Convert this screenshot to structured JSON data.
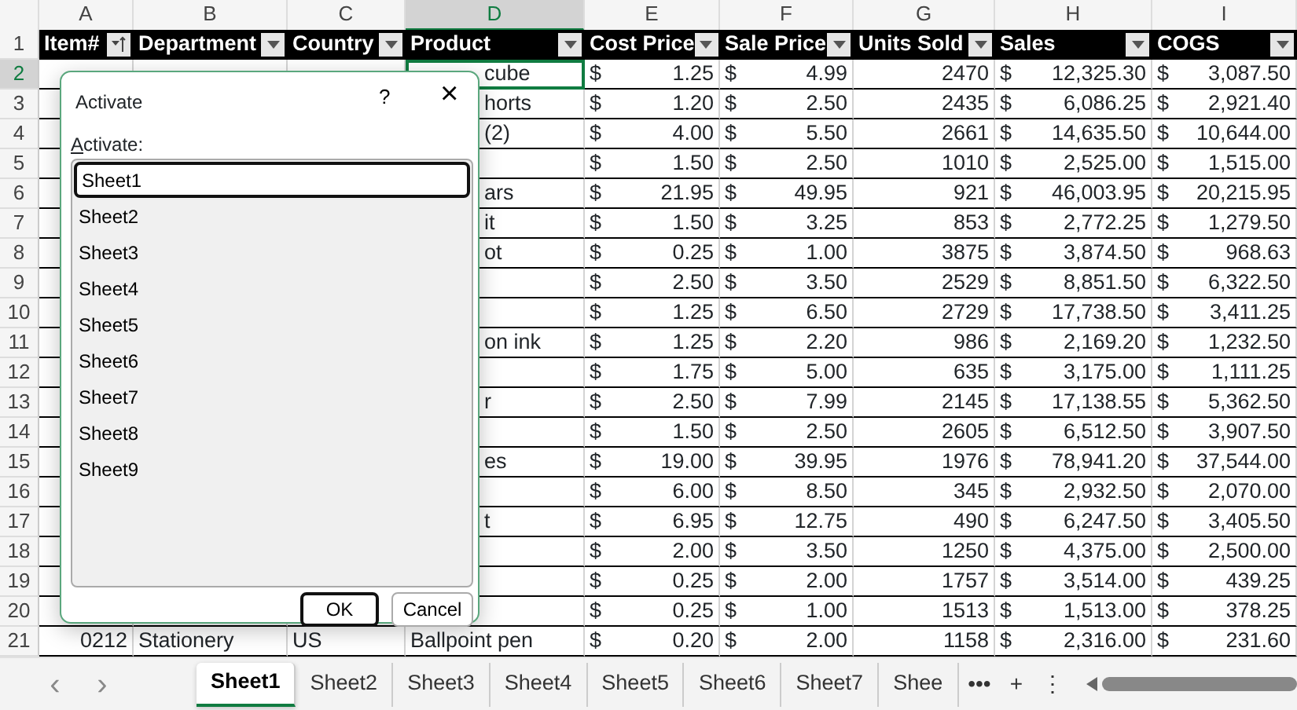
{
  "columns": [
    {
      "letter": "A",
      "selected": false
    },
    {
      "letter": "B",
      "selected": false
    },
    {
      "letter": "C",
      "selected": false
    },
    {
      "letter": "D",
      "selected": true
    },
    {
      "letter": "E",
      "selected": false
    },
    {
      "letter": "F",
      "selected": false
    },
    {
      "letter": "G",
      "selected": false
    },
    {
      "letter": "H",
      "selected": false
    },
    {
      "letter": "I",
      "selected": false
    }
  ],
  "header_row": {
    "number": "1",
    "cells": [
      {
        "label": "Item#",
        "kind": "sorted"
      },
      {
        "label": "Department",
        "kind": "filter"
      },
      {
        "label": "Country",
        "kind": "filter"
      },
      {
        "label": "Product",
        "kind": "filter"
      },
      {
        "label": "Cost Price",
        "kind": "filter"
      },
      {
        "label": "Sale Price",
        "kind": "filter"
      },
      {
        "label": "Units Sold",
        "kind": "filter"
      },
      {
        "label": "Sales",
        "kind": "filter"
      },
      {
        "label": "COGS",
        "kind": "filter"
      }
    ]
  },
  "rows": [
    {
      "number": "2",
      "selected": true,
      "cells": [
        {
          "kind": "blank"
        },
        {
          "kind": "blank"
        },
        {
          "kind": "blank"
        },
        {
          "kind": "clipped",
          "value": "cube",
          "active": true
        },
        {
          "kind": "money",
          "currency": "$",
          "value": "1.25"
        },
        {
          "kind": "money",
          "currency": "$",
          "value": "4.99"
        },
        {
          "kind": "number",
          "value": "2470"
        },
        {
          "kind": "money",
          "currency": "$",
          "value": "12,325.30"
        },
        {
          "kind": "money",
          "currency": "$",
          "value": "3,087.50"
        }
      ]
    },
    {
      "number": "3",
      "selected": false,
      "cells": [
        {
          "kind": "blank"
        },
        {
          "kind": "blank"
        },
        {
          "kind": "blank"
        },
        {
          "kind": "clipped",
          "value": "horts"
        },
        {
          "kind": "money",
          "currency": "$",
          "value": "1.20"
        },
        {
          "kind": "money",
          "currency": "$",
          "value": "2.50"
        },
        {
          "kind": "number",
          "value": "2435"
        },
        {
          "kind": "money",
          "currency": "$",
          "value": "6,086.25"
        },
        {
          "kind": "money",
          "currency": "$",
          "value": "2,921.40"
        }
      ]
    },
    {
      "number": "4",
      "selected": false,
      "cells": [
        {
          "kind": "blank"
        },
        {
          "kind": "blank"
        },
        {
          "kind": "blank"
        },
        {
          "kind": "clipped",
          "value": "(2)"
        },
        {
          "kind": "money",
          "currency": "$",
          "value": "4.00"
        },
        {
          "kind": "money",
          "currency": "$",
          "value": "5.50"
        },
        {
          "kind": "number",
          "value": "2661"
        },
        {
          "kind": "money",
          "currency": "$",
          "value": "14,635.50"
        },
        {
          "kind": "money",
          "currency": "$",
          "value": "10,644.00"
        }
      ]
    },
    {
      "number": "5",
      "selected": false,
      "cells": [
        {
          "kind": "blank"
        },
        {
          "kind": "blank"
        },
        {
          "kind": "blank"
        },
        {
          "kind": "blank"
        },
        {
          "kind": "money",
          "currency": "$",
          "value": "1.50"
        },
        {
          "kind": "money",
          "currency": "$",
          "value": "2.50"
        },
        {
          "kind": "number",
          "value": "1010"
        },
        {
          "kind": "money",
          "currency": "$",
          "value": "2,525.00"
        },
        {
          "kind": "money",
          "currency": "$",
          "value": "1,515.00"
        }
      ]
    },
    {
      "number": "6",
      "selected": false,
      "cells": [
        {
          "kind": "blank"
        },
        {
          "kind": "blank"
        },
        {
          "kind": "blank"
        },
        {
          "kind": "clipped",
          "value": "ars"
        },
        {
          "kind": "money",
          "currency": "$",
          "value": "21.95"
        },
        {
          "kind": "money",
          "currency": "$",
          "value": "49.95"
        },
        {
          "kind": "number",
          "value": "921"
        },
        {
          "kind": "money",
          "currency": "$",
          "value": "46,003.95"
        },
        {
          "kind": "money",
          "currency": "$",
          "value": "20,215.95"
        }
      ]
    },
    {
      "number": "7",
      "selected": false,
      "cells": [
        {
          "kind": "blank"
        },
        {
          "kind": "blank"
        },
        {
          "kind": "blank"
        },
        {
          "kind": "clipped",
          "value": "it"
        },
        {
          "kind": "money",
          "currency": "$",
          "value": "1.50"
        },
        {
          "kind": "money",
          "currency": "$",
          "value": "3.25"
        },
        {
          "kind": "number",
          "value": "853"
        },
        {
          "kind": "money",
          "currency": "$",
          "value": "2,772.25"
        },
        {
          "kind": "money",
          "currency": "$",
          "value": "1,279.50"
        }
      ]
    },
    {
      "number": "8",
      "selected": false,
      "cells": [
        {
          "kind": "blank"
        },
        {
          "kind": "blank"
        },
        {
          "kind": "blank"
        },
        {
          "kind": "clipped",
          "value": "ot"
        },
        {
          "kind": "money",
          "currency": "$",
          "value": "0.25"
        },
        {
          "kind": "money",
          "currency": "$",
          "value": "1.00"
        },
        {
          "kind": "number",
          "value": "3875"
        },
        {
          "kind": "money",
          "currency": "$",
          "value": "3,874.50"
        },
        {
          "kind": "money",
          "currency": "$",
          "value": "968.63"
        }
      ]
    },
    {
      "number": "9",
      "selected": false,
      "cells": [
        {
          "kind": "blank"
        },
        {
          "kind": "blank"
        },
        {
          "kind": "blank"
        },
        {
          "kind": "blank"
        },
        {
          "kind": "money",
          "currency": "$",
          "value": "2.50"
        },
        {
          "kind": "money",
          "currency": "$",
          "value": "3.50"
        },
        {
          "kind": "number",
          "value": "2529"
        },
        {
          "kind": "money",
          "currency": "$",
          "value": "8,851.50"
        },
        {
          "kind": "money",
          "currency": "$",
          "value": "6,322.50"
        }
      ]
    },
    {
      "number": "10",
      "selected": false,
      "cells": [
        {
          "kind": "blank"
        },
        {
          "kind": "blank"
        },
        {
          "kind": "blank"
        },
        {
          "kind": "blank"
        },
        {
          "kind": "money",
          "currency": "$",
          "value": "1.25"
        },
        {
          "kind": "money",
          "currency": "$",
          "value": "6.50"
        },
        {
          "kind": "number",
          "value": "2729"
        },
        {
          "kind": "money",
          "currency": "$",
          "value": "17,738.50"
        },
        {
          "kind": "money",
          "currency": "$",
          "value": "3,411.25"
        }
      ]
    },
    {
      "number": "11",
      "selected": false,
      "cells": [
        {
          "kind": "blank"
        },
        {
          "kind": "blank"
        },
        {
          "kind": "blank"
        },
        {
          "kind": "clipped",
          "value": "on ink"
        },
        {
          "kind": "money",
          "currency": "$",
          "value": "1.25"
        },
        {
          "kind": "money",
          "currency": "$",
          "value": "2.20"
        },
        {
          "kind": "number",
          "value": "986"
        },
        {
          "kind": "money",
          "currency": "$",
          "value": "2,169.20"
        },
        {
          "kind": "money",
          "currency": "$",
          "value": "1,232.50"
        }
      ]
    },
    {
      "number": "12",
      "selected": false,
      "cells": [
        {
          "kind": "blank"
        },
        {
          "kind": "blank"
        },
        {
          "kind": "blank"
        },
        {
          "kind": "blank"
        },
        {
          "kind": "money",
          "currency": "$",
          "value": "1.75"
        },
        {
          "kind": "money",
          "currency": "$",
          "value": "5.00"
        },
        {
          "kind": "number",
          "value": "635"
        },
        {
          "kind": "money",
          "currency": "$",
          "value": "3,175.00"
        },
        {
          "kind": "money",
          "currency": "$",
          "value": "1,111.25"
        }
      ]
    },
    {
      "number": "13",
      "selected": false,
      "cells": [
        {
          "kind": "blank"
        },
        {
          "kind": "blank"
        },
        {
          "kind": "blank"
        },
        {
          "kind": "clipped",
          "value": "r"
        },
        {
          "kind": "money",
          "currency": "$",
          "value": "2.50"
        },
        {
          "kind": "money",
          "currency": "$",
          "value": "7.99"
        },
        {
          "kind": "number",
          "value": "2145"
        },
        {
          "kind": "money",
          "currency": "$",
          "value": "17,138.55"
        },
        {
          "kind": "money",
          "currency": "$",
          "value": "5,362.50"
        }
      ]
    },
    {
      "number": "14",
      "selected": false,
      "cells": [
        {
          "kind": "blank"
        },
        {
          "kind": "blank"
        },
        {
          "kind": "blank"
        },
        {
          "kind": "blank"
        },
        {
          "kind": "money",
          "currency": "$",
          "value": "1.50"
        },
        {
          "kind": "money",
          "currency": "$",
          "value": "2.50"
        },
        {
          "kind": "number",
          "value": "2605"
        },
        {
          "kind": "money",
          "currency": "$",
          "value": "6,512.50"
        },
        {
          "kind": "money",
          "currency": "$",
          "value": "3,907.50"
        }
      ]
    },
    {
      "number": "15",
      "selected": false,
      "cells": [
        {
          "kind": "blank"
        },
        {
          "kind": "blank"
        },
        {
          "kind": "blank"
        },
        {
          "kind": "clipped",
          "value": "es"
        },
        {
          "kind": "money",
          "currency": "$",
          "value": "19.00"
        },
        {
          "kind": "money",
          "currency": "$",
          "value": "39.95"
        },
        {
          "kind": "number",
          "value": "1976"
        },
        {
          "kind": "money",
          "currency": "$",
          "value": "78,941.20"
        },
        {
          "kind": "money",
          "currency": "$",
          "value": "37,544.00"
        }
      ]
    },
    {
      "number": "16",
      "selected": false,
      "cells": [
        {
          "kind": "blank"
        },
        {
          "kind": "blank"
        },
        {
          "kind": "blank"
        },
        {
          "kind": "blank"
        },
        {
          "kind": "money",
          "currency": "$",
          "value": "6.00"
        },
        {
          "kind": "money",
          "currency": "$",
          "value": "8.50"
        },
        {
          "kind": "number",
          "value": "345"
        },
        {
          "kind": "money",
          "currency": "$",
          "value": "2,932.50"
        },
        {
          "kind": "money",
          "currency": "$",
          "value": "2,070.00"
        }
      ]
    },
    {
      "number": "17",
      "selected": false,
      "cells": [
        {
          "kind": "blank"
        },
        {
          "kind": "blank"
        },
        {
          "kind": "blank"
        },
        {
          "kind": "clipped",
          "value": "t"
        },
        {
          "kind": "money",
          "currency": "$",
          "value": "6.95"
        },
        {
          "kind": "money",
          "currency": "$",
          "value": "12.75"
        },
        {
          "kind": "number",
          "value": "490"
        },
        {
          "kind": "money",
          "currency": "$",
          "value": "6,247.50"
        },
        {
          "kind": "money",
          "currency": "$",
          "value": "3,405.50"
        }
      ]
    },
    {
      "number": "18",
      "selected": false,
      "cells": [
        {
          "kind": "blank"
        },
        {
          "kind": "blank"
        },
        {
          "kind": "blank"
        },
        {
          "kind": "blank"
        },
        {
          "kind": "money",
          "currency": "$",
          "value": "2.00"
        },
        {
          "kind": "money",
          "currency": "$",
          "value": "3.50"
        },
        {
          "kind": "number",
          "value": "1250"
        },
        {
          "kind": "money",
          "currency": "$",
          "value": "4,375.00"
        },
        {
          "kind": "money",
          "currency": "$",
          "value": "2,500.00"
        }
      ]
    },
    {
      "number": "19",
      "selected": false,
      "cells": [
        {
          "kind": "blank"
        },
        {
          "kind": "blank"
        },
        {
          "kind": "blank"
        },
        {
          "kind": "blank"
        },
        {
          "kind": "money",
          "currency": "$",
          "value": "0.25"
        },
        {
          "kind": "money",
          "currency": "$",
          "value": "2.00"
        },
        {
          "kind": "number",
          "value": "1757"
        },
        {
          "kind": "money",
          "currency": "$",
          "value": "3,514.00"
        },
        {
          "kind": "money",
          "currency": "$",
          "value": "439.25"
        }
      ]
    },
    {
      "number": "20",
      "selected": false,
      "cells": [
        {
          "kind": "blank"
        },
        {
          "kind": "blank"
        },
        {
          "kind": "blank"
        },
        {
          "kind": "blank"
        },
        {
          "kind": "money",
          "currency": "$",
          "value": "0.25"
        },
        {
          "kind": "money",
          "currency": "$",
          "value": "1.00"
        },
        {
          "kind": "number",
          "value": "1513"
        },
        {
          "kind": "money",
          "currency": "$",
          "value": "1,513.00"
        },
        {
          "kind": "money",
          "currency": "$",
          "value": "378.25"
        }
      ]
    },
    {
      "number": "21",
      "selected": false,
      "cells": [
        {
          "kind": "number",
          "value": "0212"
        },
        {
          "kind": "text",
          "value": "Stationery"
        },
        {
          "kind": "text",
          "value": "US"
        },
        {
          "kind": "text",
          "value": "Ballpoint pen"
        },
        {
          "kind": "money",
          "currency": "$",
          "value": "0.20"
        },
        {
          "kind": "money",
          "currency": "$",
          "value": "2.00"
        },
        {
          "kind": "number",
          "value": "1158"
        },
        {
          "kind": "money",
          "currency": "$",
          "value": "2,316.00"
        },
        {
          "kind": "money",
          "currency": "$",
          "value": "231.60"
        }
      ]
    }
  ],
  "dialog": {
    "title": "Activate",
    "help": "?",
    "close": "×",
    "label": "Activate:",
    "items": [
      {
        "label": "Sheet1",
        "selected": true
      },
      {
        "label": "Sheet2",
        "selected": false
      },
      {
        "label": "Sheet3",
        "selected": false
      },
      {
        "label": "Sheet4",
        "selected": false
      },
      {
        "label": "Sheet5",
        "selected": false
      },
      {
        "label": "Sheet6",
        "selected": false
      },
      {
        "label": "Sheet7",
        "selected": false
      },
      {
        "label": "Sheet8",
        "selected": false
      },
      {
        "label": "Sheet9",
        "selected": false
      }
    ],
    "buttons": [
      {
        "label": "OK",
        "default": true
      },
      {
        "label": "Cancel",
        "default": false
      }
    ]
  },
  "sheet_tabs": {
    "prev": "‹",
    "next": "›",
    "more": "•••",
    "add": "+",
    "options": "⋮",
    "tabs": [
      {
        "label": "Sheet1",
        "selected": true
      },
      {
        "label": "Sheet2",
        "selected": false
      },
      {
        "label": "Sheet3",
        "selected": false
      },
      {
        "label": "Sheet4",
        "selected": false
      },
      {
        "label": "Sheet5",
        "selected": false
      },
      {
        "label": "Sheet6",
        "selected": false
      },
      {
        "label": "Sheet7",
        "selected": false
      },
      {
        "label": "Shee",
        "selected": false
      }
    ]
  }
}
